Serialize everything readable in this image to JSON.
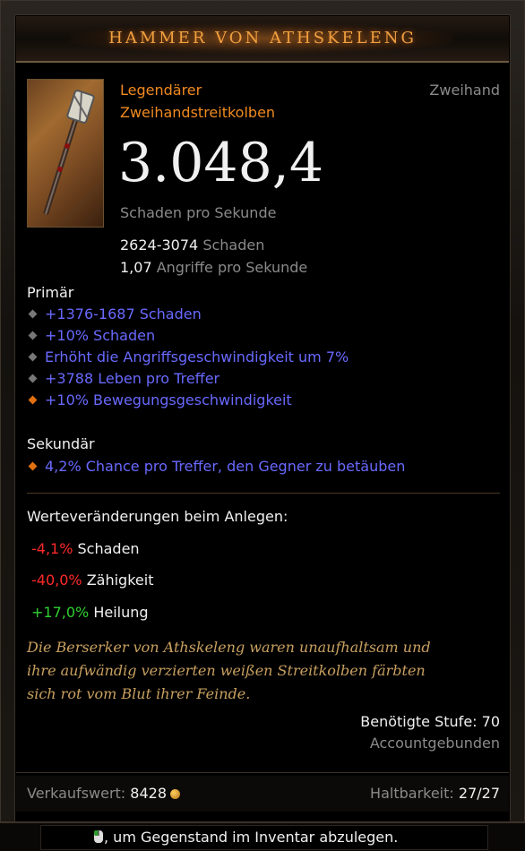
{
  "item": {
    "name": "HAMMER VON ATHSKELENG",
    "rarity_line1": "Legendärer",
    "rarity_line2": "Zweihandstreitkolben",
    "slot": "Zweihand",
    "dps": "3.048,4",
    "dps_label": "Schaden pro Sekunde",
    "damage_range": "2624-3074",
    "damage_label": "Schaden",
    "aps_value": "1,07",
    "aps_label": "Angriffe pro Sekunde"
  },
  "primary": {
    "heading": "Primär",
    "stats": [
      {
        "text": "+1376-1687 Schaden",
        "bullet": "grey"
      },
      {
        "text": "+10% Schaden",
        "bullet": "grey"
      },
      {
        "text": "Erhöht die Angriffsgeschwindigkeit um 7%",
        "bullet": "grey"
      },
      {
        "text": "+3788 Leben pro Treffer",
        "bullet": "grey"
      },
      {
        "text": "+10% Bewegungsgeschwindigkeit",
        "bullet": "orange"
      }
    ]
  },
  "secondary": {
    "heading": "Sekundär",
    "stats": [
      {
        "text": "4,2% Chance pro Treffer, den Gegner zu betäuben",
        "bullet": "orange"
      }
    ]
  },
  "comparison": {
    "heading": "Werteveränderungen beim Anlegen:",
    "rows": [
      {
        "value": "-4,1%",
        "label": "Schaden"
      },
      {
        "value": "-40,0%",
        "label": "Zähigkeit"
      },
      {
        "value": "+17,0%",
        "label": "Heilung"
      }
    ]
  },
  "flavor": {
    "line1": "Die Berserker von Athskeleng waren unaufhaltsam und",
    "line2": "ihre aufwändig verzierten weißen Streitkolben färbten",
    "line3": "sich rot vom Blut ihrer Feinde."
  },
  "requirements": {
    "level": "Benötigte Stufe: 70",
    "binding": "Accountgebunden"
  },
  "footer": {
    "sell_label": "Verkaufswert:",
    "sell_value": "8428",
    "durability_label": "Haltbarkeit:",
    "durability_value": "27/27"
  },
  "hint": {
    "text": ", um Gegenstand im Inventar abzulegen."
  },
  "colors": {
    "legendary": "#f08a20",
    "magic": "#6969ff",
    "negative": "#ff2a2a",
    "positive": "#30d030",
    "flavor": "#c8a060"
  }
}
